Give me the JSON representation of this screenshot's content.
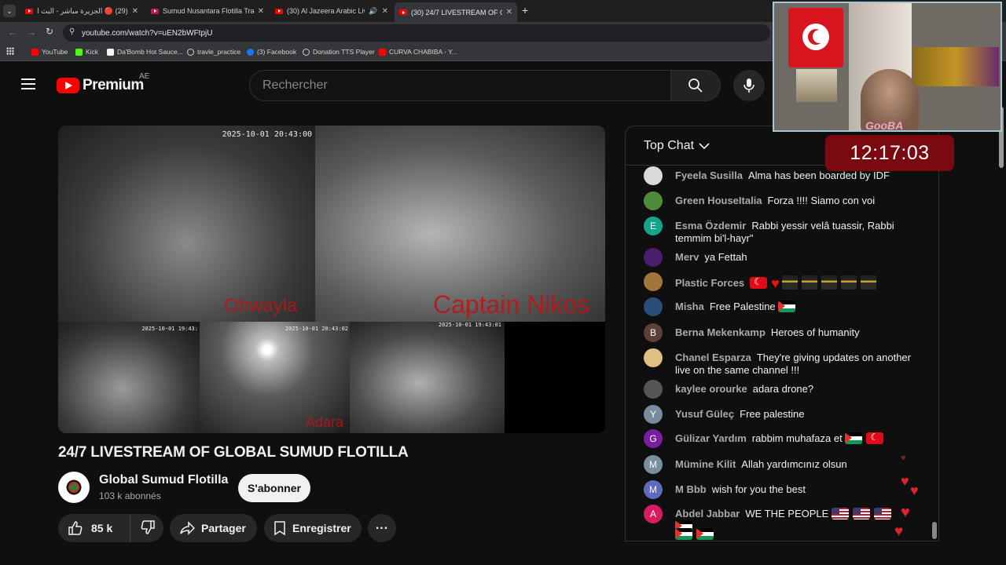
{
  "browser": {
    "tabs": [
      {
        "title": "(29) 🔴 الجزيرة مباشر - البث الح",
        "active": false
      },
      {
        "title": "Sumud Nusantara Flotilla Track",
        "active": false
      },
      {
        "title": "(30) Al Jazeera Arabic Live",
        "active": false
      },
      {
        "title": "(30) 24/7 LIVESTREAM OF GLOBA",
        "active": true
      }
    ],
    "url": "youtube.com/watch?v=uEN2bWFtpjU",
    "bookmarks": [
      "YouTube",
      "Kick",
      "Da'Bomb Hot Sauce...",
      "travle_practice",
      "(3) Facebook",
      "Donation TTS Player",
      "CURVA CHABIBA - Y..."
    ]
  },
  "youtube": {
    "logo_text": "Premium",
    "region": "AE",
    "search_placeholder": "Rechercher"
  },
  "video": {
    "cams": [
      {
        "timestamp": "2025-10-01 20:43:00"
      },
      {
        "timestamp": "",
        "label": "Ohwayla"
      },
      {
        "timestamp": "",
        "label": "Captain Nikos"
      },
      {
        "timestamp": "2025-10-01 19:43:"
      },
      {
        "timestamp": "2025-10-01 20:43:02",
        "label": "Adara"
      },
      {
        "timestamp": "2025-10-01 19:43:01"
      }
    ],
    "title": "24/7 LIVESTREAM OF GLOBAL SUMUD FLOTILLA",
    "channel": "Global Sumud Flotilla",
    "subscribers": "103 k abonnés",
    "subscribe_label": "S'abonner",
    "likes": "85 k",
    "share_label": "Partager",
    "save_label": "Enregistrer",
    "more_label": "..."
  },
  "chat": {
    "header": "Top Chat",
    "messages": [
      {
        "author": "Fyeela Susilla",
        "text": "Alma has been boarded by IDF",
        "avatar": "",
        "color": "#d9d9d9"
      },
      {
        "author": "Green HouseItalia",
        "text": "Forza !!!! Siamo con voi",
        "avatar": "",
        "color": "#4f8a3a"
      },
      {
        "author": "Esma Özdemir",
        "text": "Rabbi yessir velâ tuassir, Rabbi temmim bi'l-hayr\"",
        "avatar": "E",
        "color": "#12a58a"
      },
      {
        "author": "Merv",
        "text": "ya Fettah",
        "avatar": "",
        "color": "#4b1e6e"
      },
      {
        "author": "Plastic Forces",
        "text": "",
        "avatar": "",
        "color": "#a0763a"
      },
      {
        "author": "Misha",
        "text": "Free Palestine",
        "avatar": "",
        "color": "#2a4d7a"
      },
      {
        "author": "Berna Mekenkamp",
        "text": "Heroes of humanity",
        "avatar": "B",
        "color": "#5d4037"
      },
      {
        "author": "Chanel Esparza",
        "text": "They're giving updates on another live on the same channel !!!",
        "avatar": "",
        "color": "#e0c080"
      },
      {
        "author": "kaylee orourke",
        "text": "adara drone?",
        "avatar": "",
        "color": "#555"
      },
      {
        "author": "Yusuf Güleç",
        "text": "Free palestine",
        "avatar": "Y",
        "color": "#7a8aa0"
      },
      {
        "author": "Gülizar Yardım",
        "text": "rabbim muhafaza et",
        "avatar": "G",
        "color": "#7b1fa2"
      },
      {
        "author": "Mümine Kilit",
        "text": "Allah yardımcınız olsun",
        "avatar": "M",
        "color": "#78909c"
      },
      {
        "author": "M Bbb",
        "text": "wish for you the best",
        "avatar": "M",
        "color": "#5c6bc0"
      },
      {
        "author": "Abdel Jabbar",
        "text": "WE THE PEOPLE",
        "avatar": "A",
        "color": "#d81b60"
      }
    ]
  },
  "overlay": {
    "timer": "12:17:03",
    "streamer_tag": "GooBA"
  }
}
